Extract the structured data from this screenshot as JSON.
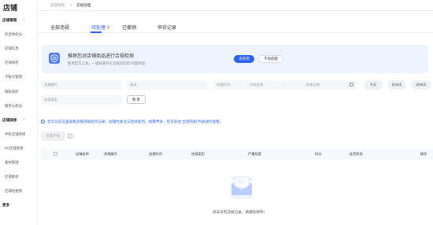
{
  "sidebar": {
    "brand": "店铺",
    "groups": [
      {
        "label": "店铺管理",
        "caret": "^",
        "items": [
          "综合体验分",
          "店铺信息",
          "店铺体检",
          "子账号管理",
          "隐私保护",
          "服务与权益"
        ]
      },
      {
        "label": "店铺装修",
        "caret": "^",
        "items": [
          "手机店铺装修",
          "PC店铺装修",
          "素材管理",
          "店铺素材",
          "店铺短视频"
        ]
      }
    ],
    "more": "更多"
  },
  "breadcrumb": {
    "parent": "店铺体检",
    "separator": ">",
    "current": "违规处理"
  },
  "tabs": [
    {
      "label": "全部违规",
      "count": ""
    },
    {
      "label": "待处理",
      "count": "0"
    },
    {
      "label": "已撤销",
      "count": ""
    },
    {
      "label": "申诉记录",
      "count": ""
    }
  ],
  "banner": {
    "title": "推荐您对店铺商品进行合规检测",
    "subtitle": "使用官方工具，一键排查存在违规风险的\"问题商品\"",
    "primary_button": "去检测",
    "secondary_button": "不再提醒"
  },
  "filters": {
    "violation_no_placeholder": "违规编号",
    "select_placeholder": "请选",
    "time_label": "违规时间",
    "start_date": "开始日期",
    "date_sep": "-",
    "end_date": "结束日期",
    "quick_ranges": [
      "今天",
      "近30天",
      "近90天"
    ],
    "type_placeholder": "违规类型",
    "search_button": "搜 索"
  },
  "notice": "您可以在这里查看店铺违规处罚记录，处理时关注与后续处罚。如需申诉，您可前往“全部违规”列表进行查看。",
  "batch_button": "批量申诉",
  "table": {
    "columns": [
      "店铺名称",
      "违规编号",
      "违规时间",
      "违规类型",
      "严重程度",
      "扣分",
      "处罚状态",
      "操作"
    ]
  },
  "empty_text": "尚未没有违规记录，请继续保持！",
  "colors": {
    "accent": "#2962ff",
    "count": "#f05a28",
    "banner_bg": "#eef4ff"
  }
}
